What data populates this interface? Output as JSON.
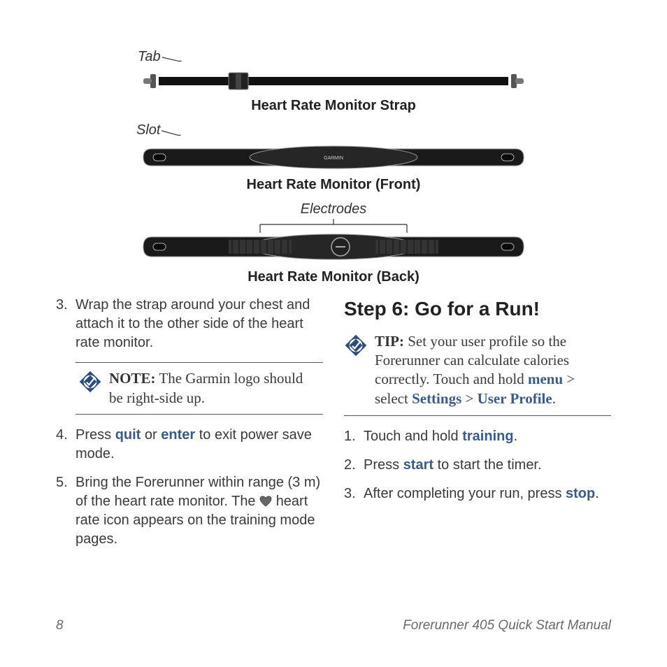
{
  "diagrams": {
    "tab_label": "Tab",
    "strap_caption": "Heart Rate Monitor Strap",
    "slot_label": "Slot",
    "front_caption": "Heart Rate Monitor (Front)",
    "electrodes_label": "Electrodes",
    "back_caption": "Heart Rate Monitor (Back)"
  },
  "left": {
    "step3_num": "3.",
    "step3_text": "Wrap the strap around your chest and attach it to the other side of the heart rate monitor.",
    "note_label": "NOTE:",
    "note_text": " The Garmin logo should be right-side up.",
    "step4_num": "4.",
    "step4_a": "Press ",
    "step4_quit": "quit",
    "step4_or": " or ",
    "step4_enter": "enter",
    "step4_b": " to exit power save mode.",
    "step5_num": "5.",
    "step5_a": "Bring the Forerunner within range (3 m) of the heart rate monitor. The ",
    "step5_b": " heart rate icon appears on the training mode pages."
  },
  "right": {
    "heading": "Step 6: Go for a Run!",
    "tip_label": "TIP:",
    "tip_a": " Set your user profile so the Forerunner can calculate calories correctly. Touch and hold ",
    "tip_menu": "menu",
    "tip_gt1": " > select ",
    "tip_settings": "Settings",
    "tip_gt2": " > ",
    "tip_profile": "User Profile",
    "tip_end": ".",
    "s1_num": "1.",
    "s1_a": "Touch and hold ",
    "s1_training": "training",
    "s1_b": ".",
    "s2_num": "2.",
    "s2_a": "Press ",
    "s2_start": "start",
    "s2_b": " to start the timer.",
    "s3_num": "3.",
    "s3_a": "After completing your run, press ",
    "s3_stop": "stop",
    "s3_b": "."
  },
  "footer": {
    "page": "8",
    "title": "Forerunner 405 Quick Start Manual"
  }
}
